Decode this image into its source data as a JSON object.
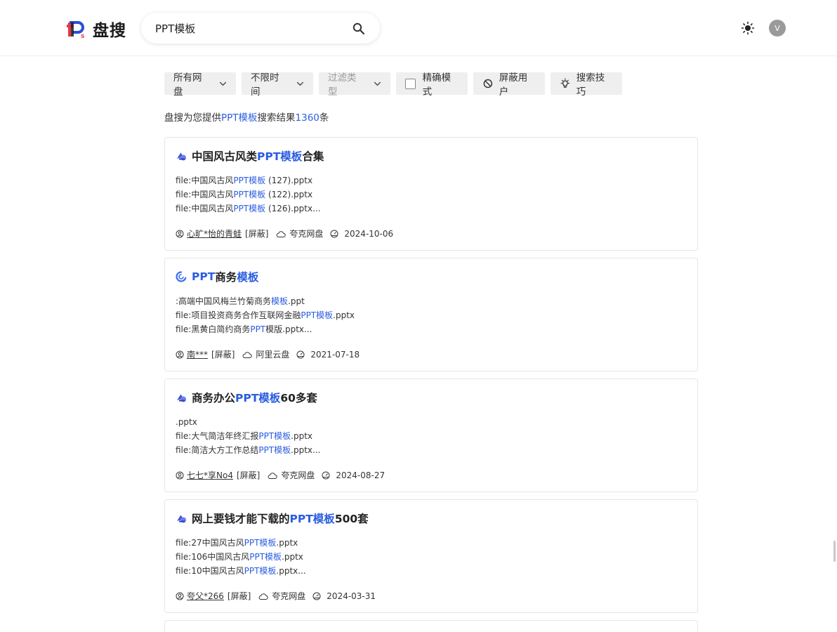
{
  "brand": {
    "name": "盘搜"
  },
  "search": {
    "value": "PPT模板"
  },
  "header": {
    "avatar_letter": "V"
  },
  "filters": {
    "pan": "所有网盘",
    "time": "不限时间",
    "type": "过滤类型",
    "exact": "精确模式",
    "block_user": "屏蔽用户",
    "tips": "搜索技巧"
  },
  "summary": {
    "prefix": "盘搜为您提供",
    "keyword": "PPT模板",
    "middle": "搜索结果",
    "count": "1360",
    "suffix": "条"
  },
  "colors": {
    "accent": "#2a5de0",
    "brand_red": "#e8344e",
    "brand_blue": "#2a4fd8"
  },
  "results": [
    {
      "source_icon": "quark-cloud-icon",
      "title": [
        {
          "t": "中国风古风类",
          "h": false
        },
        {
          "t": "PPT模板",
          "h": true
        },
        {
          "t": "合集",
          "h": false
        }
      ],
      "files": [
        [
          {
            "t": "file:中国风古风",
            "h": false
          },
          {
            "t": "PPT模板",
            "h": true
          },
          {
            "t": " (127).pptx",
            "h": false
          }
        ],
        [
          {
            "t": "file:中国风古风",
            "h": false
          },
          {
            "t": "PPT模板",
            "h": true
          },
          {
            "t": " (122).pptx",
            "h": false
          }
        ],
        [
          {
            "t": "file:中国风古风",
            "h": false
          },
          {
            "t": "PPT模板",
            "h": true
          },
          {
            "t": " (126).pptx...",
            "h": false
          }
        ]
      ],
      "user": "心旷*怡的青蛙",
      "block": "[屏蔽]",
      "pan": "夸克网盘",
      "date": "2024-10-06"
    },
    {
      "source_icon": "aliyun-drive-icon",
      "title": [
        {
          "t": "PPT",
          "h": true
        },
        {
          "t": "商务",
          "h": false
        },
        {
          "t": "模板",
          "h": true
        }
      ],
      "files": [
        [
          {
            "t": ":高端中国风梅兰竹菊商务",
            "h": false
          },
          {
            "t": "模板",
            "h": true
          },
          {
            "t": ".ppt",
            "h": false
          }
        ],
        [
          {
            "t": "file:项目投资商务合作互联网金融",
            "h": false
          },
          {
            "t": "PPT模板",
            "h": true
          },
          {
            "t": ".pptx",
            "h": false
          }
        ],
        [
          {
            "t": "file:黑黄白简约商务",
            "h": false
          },
          {
            "t": "PPT",
            "h": true
          },
          {
            "t": "模版.pptx...",
            "h": false
          }
        ]
      ],
      "user": "南***",
      "block": "[屏蔽]",
      "pan": "阿里云盘",
      "date": "2021-07-18"
    },
    {
      "source_icon": "quark-cloud-icon",
      "title": [
        {
          "t": "商务办公",
          "h": false
        },
        {
          "t": "PPT模板",
          "h": true
        },
        {
          "t": "60多套",
          "h": false
        }
      ],
      "files": [
        [
          {
            "t": ".pptx",
            "h": false
          }
        ],
        [
          {
            "t": "file:大气简洁年终汇报",
            "h": false
          },
          {
            "t": "PPT模板",
            "h": true
          },
          {
            "t": ".pptx",
            "h": false
          }
        ],
        [
          {
            "t": "file:简洁大方工作总结",
            "h": false
          },
          {
            "t": "PPT模板",
            "h": true
          },
          {
            "t": ".pptx...",
            "h": false
          }
        ]
      ],
      "user": "七七*享No4",
      "block": "[屏蔽]",
      "pan": "夸克网盘",
      "date": "2024-08-27"
    },
    {
      "source_icon": "quark-cloud-icon",
      "title": [
        {
          "t": "网上要钱才能下载的",
          "h": false
        },
        {
          "t": "PPT模板",
          "h": true
        },
        {
          "t": "500套",
          "h": false
        }
      ],
      "files": [
        [
          {
            "t": "file:27中国风古风",
            "h": false
          },
          {
            "t": "PPT模板",
            "h": true
          },
          {
            "t": ".pptx",
            "h": false
          }
        ],
        [
          {
            "t": "file:106中国风古风",
            "h": false
          },
          {
            "t": "PPT模板",
            "h": true
          },
          {
            "t": ".pptx",
            "h": false
          }
        ],
        [
          {
            "t": "file:10中国风古风",
            "h": false
          },
          {
            "t": "PPT模板",
            "h": true
          },
          {
            "t": ".pptx...",
            "h": false
          }
        ]
      ],
      "user": "夸父*266",
      "block": "[屏蔽]",
      "pan": "夸克网盘",
      "date": "2024-03-31"
    }
  ]
}
